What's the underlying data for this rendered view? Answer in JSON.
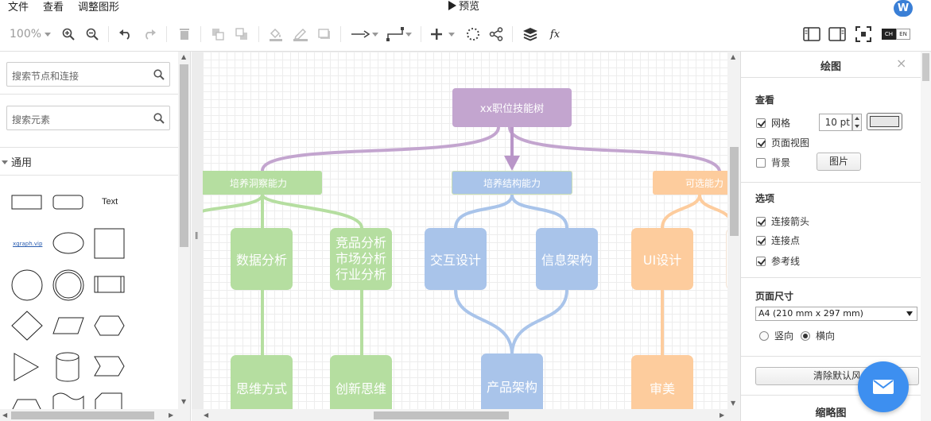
{
  "menu": {
    "file": "文件",
    "view": "查看",
    "adjust": "调整图形",
    "preview": "预览",
    "avatar_letter": "W"
  },
  "toolbar": {
    "zoom": "100%",
    "lang_ch": "CH",
    "lang_en": "EN"
  },
  "left": {
    "search_nodes_placeholder": "搜索节点和连接",
    "search_elements_placeholder": "搜索元素",
    "section_general": "通用",
    "shape_text": "Text",
    "shape_link": "xgraph.vip"
  },
  "diagram": {
    "root": "xx职位技能树",
    "branches": [
      {
        "label": "培养洞察能力",
        "color": "#b5dea0"
      },
      {
        "label": "培养结构能力",
        "color": "#a9c4ea"
      },
      {
        "label": "可选能力",
        "color": "#fdcc9d"
      }
    ],
    "nodes": {
      "data_analysis": "数据分析",
      "competitive_1": "竞品分析",
      "competitive_2": "市场分析",
      "competitive_3": "行业分析",
      "interaction": "交互设计",
      "info_arch": "信息架构",
      "ui_design": "UI设计",
      "thinking": "思维方式",
      "innovation": "创新思维",
      "product_arch": "产品架构",
      "aesthetics": "审美"
    },
    "colors": {
      "root": "#c3a5cf",
      "root_line": "#b996c8",
      "green": "#b5dea0",
      "blue": "#a9c4ea",
      "orange": "#fdcc9d"
    }
  },
  "right": {
    "title": "绘图",
    "close": "×",
    "section_view": "查看",
    "grid": "网格",
    "grid_size": "10 pt",
    "page_view": "页面视图",
    "background": "背景",
    "image_btn": "图片",
    "section_options": "选项",
    "connect_arrows": "连接箭头",
    "connect_points": "连接点",
    "guides": "参考线",
    "section_page_size": "页面尺寸",
    "page_size_value": "A4 (210 mm x 297 mm)",
    "portrait": "竖向",
    "landscape": "横向",
    "reset_btn": "清除默认风",
    "thumbnail": "缩略图"
  }
}
